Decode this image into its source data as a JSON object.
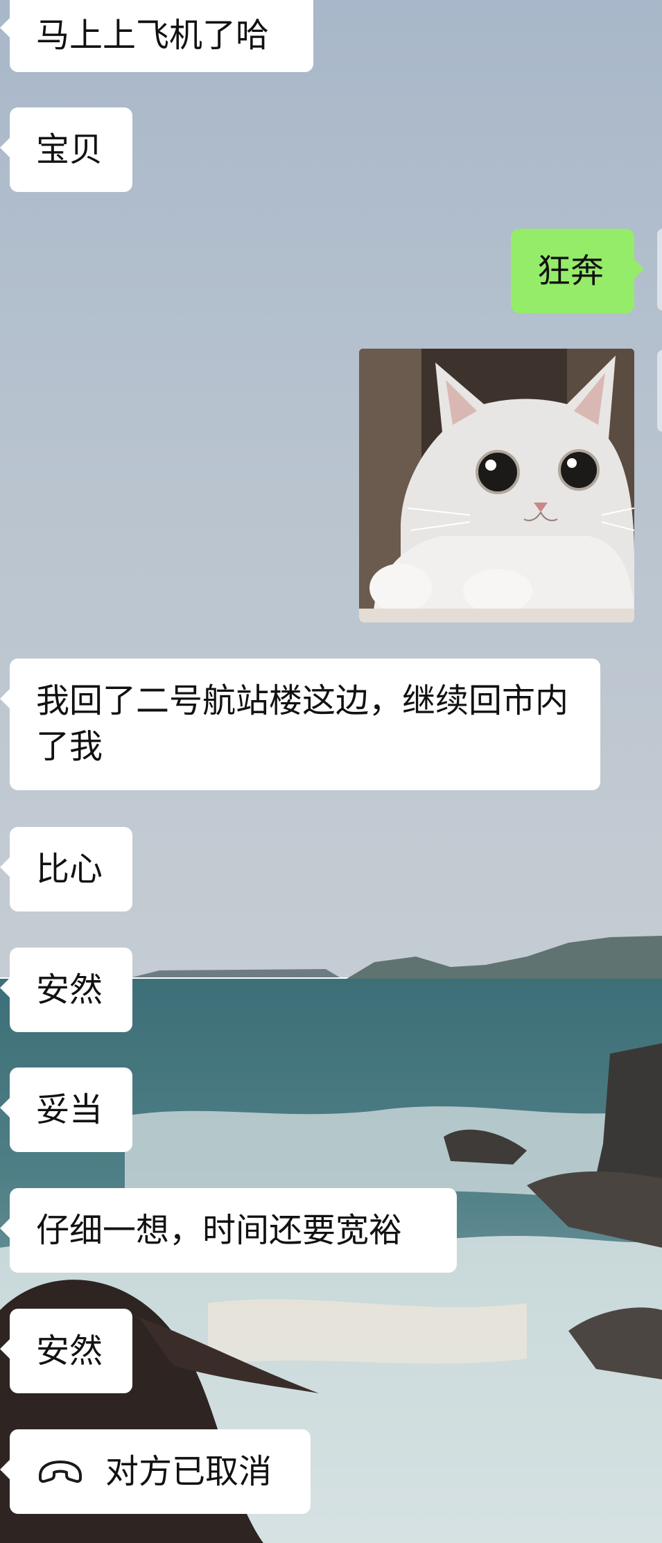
{
  "chat": {
    "messages": [
      {
        "side": "left",
        "text": "马上上飞机了哈"
      },
      {
        "side": "left",
        "text": "宝贝"
      },
      {
        "side": "right",
        "text": "狂奔"
      },
      {
        "side": "right",
        "type": "image",
        "image": "cat-sticker"
      },
      {
        "side": "left",
        "text": "我回了二号航站楼这边，继续回市内了我"
      },
      {
        "side": "left",
        "text": "比心"
      },
      {
        "side": "left",
        "text": "安然"
      },
      {
        "side": "left",
        "text": "妥当"
      },
      {
        "side": "left",
        "text": "仔细一想，时间还要宽裕"
      },
      {
        "side": "left",
        "text": "安然"
      },
      {
        "side": "left",
        "type": "call",
        "icon": "phone-hangup-icon",
        "text": "对方已取消"
      }
    ]
  },
  "colors": {
    "bubble_in": "#ffffff",
    "bubble_out": "#95ec69"
  }
}
